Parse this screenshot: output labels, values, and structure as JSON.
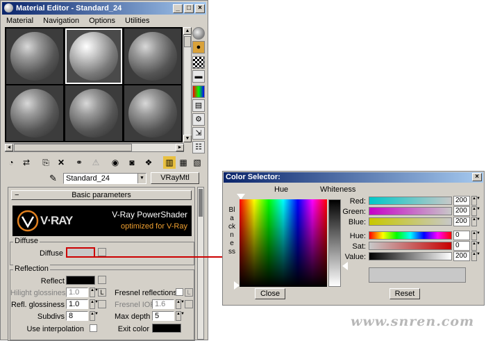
{
  "material_editor": {
    "title": "Material Editor - Standard_24",
    "menu": [
      "Material",
      "Navigation",
      "Options",
      "Utilities"
    ],
    "material_name": "Standard_24",
    "material_type": "VRayMtl",
    "rollout_title": "Basic parameters",
    "banner_title": "V-Ray PowerShader",
    "banner_subtitle": "optimized for V-Ray",
    "vray_logo": "V·RAY",
    "diffuse": {
      "group": "Diffuse",
      "label": "Diffuse"
    },
    "reflection": {
      "group": "Reflection",
      "reflect_label": "Reflect",
      "hilight_label": "Hilight glossiness",
      "hilight_value": "1.0",
      "lock_label": "L",
      "refl_gloss_label": "Refl. glossiness",
      "refl_gloss_value": "1.0",
      "subdivs_label": "Subdivs",
      "subdivs_value": "8",
      "use_interp_label": "Use interpolation",
      "fresnel_label": "Fresnel reflections",
      "fresnel_ior_label": "Fresnel IOR",
      "fresnel_ior_value": "1.6",
      "max_depth_label": "Max depth",
      "max_depth_value": "5",
      "exit_color_label": "Exit color"
    }
  },
  "color_selector": {
    "title": "Color Selector:",
    "hue_label": "Hue",
    "whiteness_label": "Whiteness",
    "blackness_label": "Blackness",
    "channels": [
      {
        "label": "Red:",
        "value": "200"
      },
      {
        "label": "Green:",
        "value": "200"
      },
      {
        "label": "Blue:",
        "value": "200"
      },
      {
        "label": "Hue:",
        "value": "0"
      },
      {
        "label": "Sat:",
        "value": "0"
      },
      {
        "label": "Value:",
        "value": "200"
      }
    ],
    "close_label": "Close",
    "reset_label": "Reset"
  },
  "watermark": "www.snren.com",
  "colors": {
    "highlight_red": "#cc0000",
    "title_blue": "#0a246a"
  }
}
